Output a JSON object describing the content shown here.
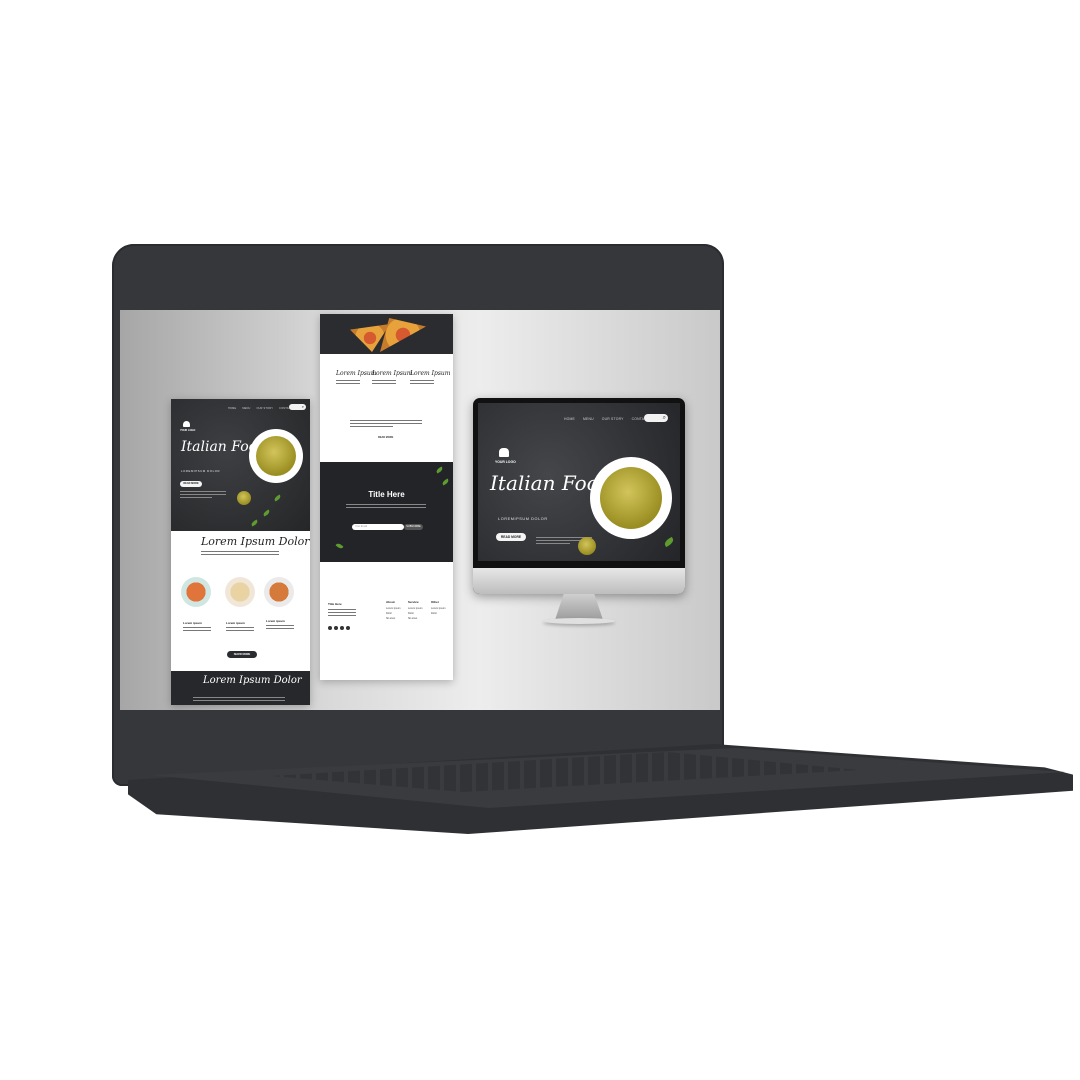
{
  "mobile": {
    "nav": [
      "HOME",
      "MENU",
      "OUR STORY",
      "CONTACT US"
    ],
    "logo": "YOUR LOGO",
    "hero_title": "Italian Food",
    "hero_subtitle": "LOREMIPSUM DOLOR",
    "hero_button": "READ MORE",
    "section_title": "Lorem Ipsum Dolor",
    "dishes": [
      {
        "label": "Lorem ipsum"
      },
      {
        "label": "Lorem ipsum"
      },
      {
        "label": "Lorem ipsum"
      }
    ],
    "show_more": "SHOW MORE",
    "footer_title": "Lorem Ipsum Dolor"
  },
  "longpage": {
    "pizza_captions": [
      "Lorem Ipsum",
      "Lorem Ipsum",
      "Lorem Ipsum"
    ],
    "read_more": "READ MORE",
    "band_title": "Title Here",
    "subscribe_placeholder": "Your Email",
    "subscribe_button": "SUBSCRIBE",
    "footer_columns": [
      {
        "title": "Title Here",
        "items": []
      },
      {
        "title": "About",
        "items": [
          "Lorem ipsum",
          "Dolor",
          "Sit amet"
        ]
      },
      {
        "title": "Service",
        "items": [
          "Lorem ipsum",
          "Dolor",
          "Sit amet"
        ]
      },
      {
        "title": "Other",
        "items": [
          "Lorem ipsum",
          "Dolor"
        ]
      }
    ]
  },
  "desktop": {
    "nav": [
      "HOME",
      "MENU",
      "OUR STORY",
      "CONTACT US"
    ],
    "logo": "YOUR LOGO",
    "hero_title": "Italian Food",
    "hero_subtitle": "LOREMIPSUM DOLOR",
    "hero_button": "READ MORE"
  },
  "colors": {
    "laptop_body": "#36373a",
    "dark_panel": "#27282b",
    "leaf_green": "#5f9c2f",
    "pasta": "#b9ab3a"
  }
}
